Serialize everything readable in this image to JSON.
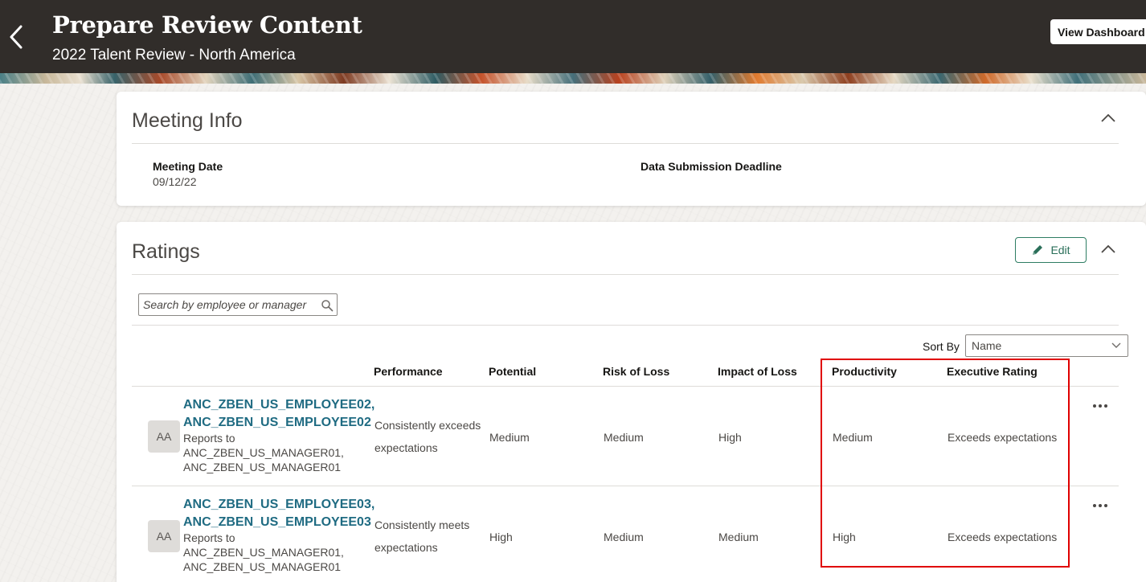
{
  "header": {
    "title": "Prepare Review Content",
    "subtitle": "2022 Talent Review - North America",
    "view_dashboard_label": "View Dashboard",
    "back_icon": "chevron-left-icon"
  },
  "meeting_info": {
    "title": "Meeting Info",
    "fields": [
      {
        "label": "Meeting Date",
        "value": "09/12/22"
      },
      {
        "label": "Data Submission Deadline",
        "value": ""
      }
    ]
  },
  "ratings": {
    "title": "Ratings",
    "edit_label": "Edit",
    "search_placeholder": "Search by employee or manager",
    "sort_label": "Sort By",
    "sort_value": "Name",
    "columns": [
      "Performance",
      "Potential",
      "Risk of Loss",
      "Impact of Loss",
      "Productivity",
      "Executive Rating"
    ],
    "rows": [
      {
        "initials": "AA",
        "name_line1": "ANC_ZBEN_US_EMPLOYEE02,",
        "name_line2": "ANC_ZBEN_US_EMPLOYEE02",
        "reports_to": "Reports to",
        "manager_line1": "ANC_ZBEN_US_MANAGER01,",
        "manager_line2": "ANC_ZBEN_US_MANAGER01",
        "performance_line1": "Consistently exceeds",
        "performance_line2": "expectations",
        "potential": "Medium",
        "risk_of_loss": "Medium",
        "impact_of_loss": "High",
        "productivity": "Medium",
        "executive_rating": "Exceeds expectations"
      },
      {
        "initials": "AA",
        "name_line1": "ANC_ZBEN_US_EMPLOYEE03,",
        "name_line2": "ANC_ZBEN_US_EMPLOYEE03",
        "reports_to": "Reports to",
        "manager_line1": "ANC_ZBEN_US_MANAGER01,",
        "manager_line2": "ANC_ZBEN_US_MANAGER01",
        "performance_line1": "Consistently meets",
        "performance_line2": "expectations",
        "potential": "High",
        "risk_of_loss": "Medium",
        "impact_of_loss": "Medium",
        "productivity": "High",
        "executive_rating": "Exceeds expectations"
      }
    ]
  },
  "colors": {
    "header_bg": "#312d2a",
    "link": "#1f6b82",
    "edit_accent": "#2e7d63",
    "highlight": "#e00000"
  }
}
